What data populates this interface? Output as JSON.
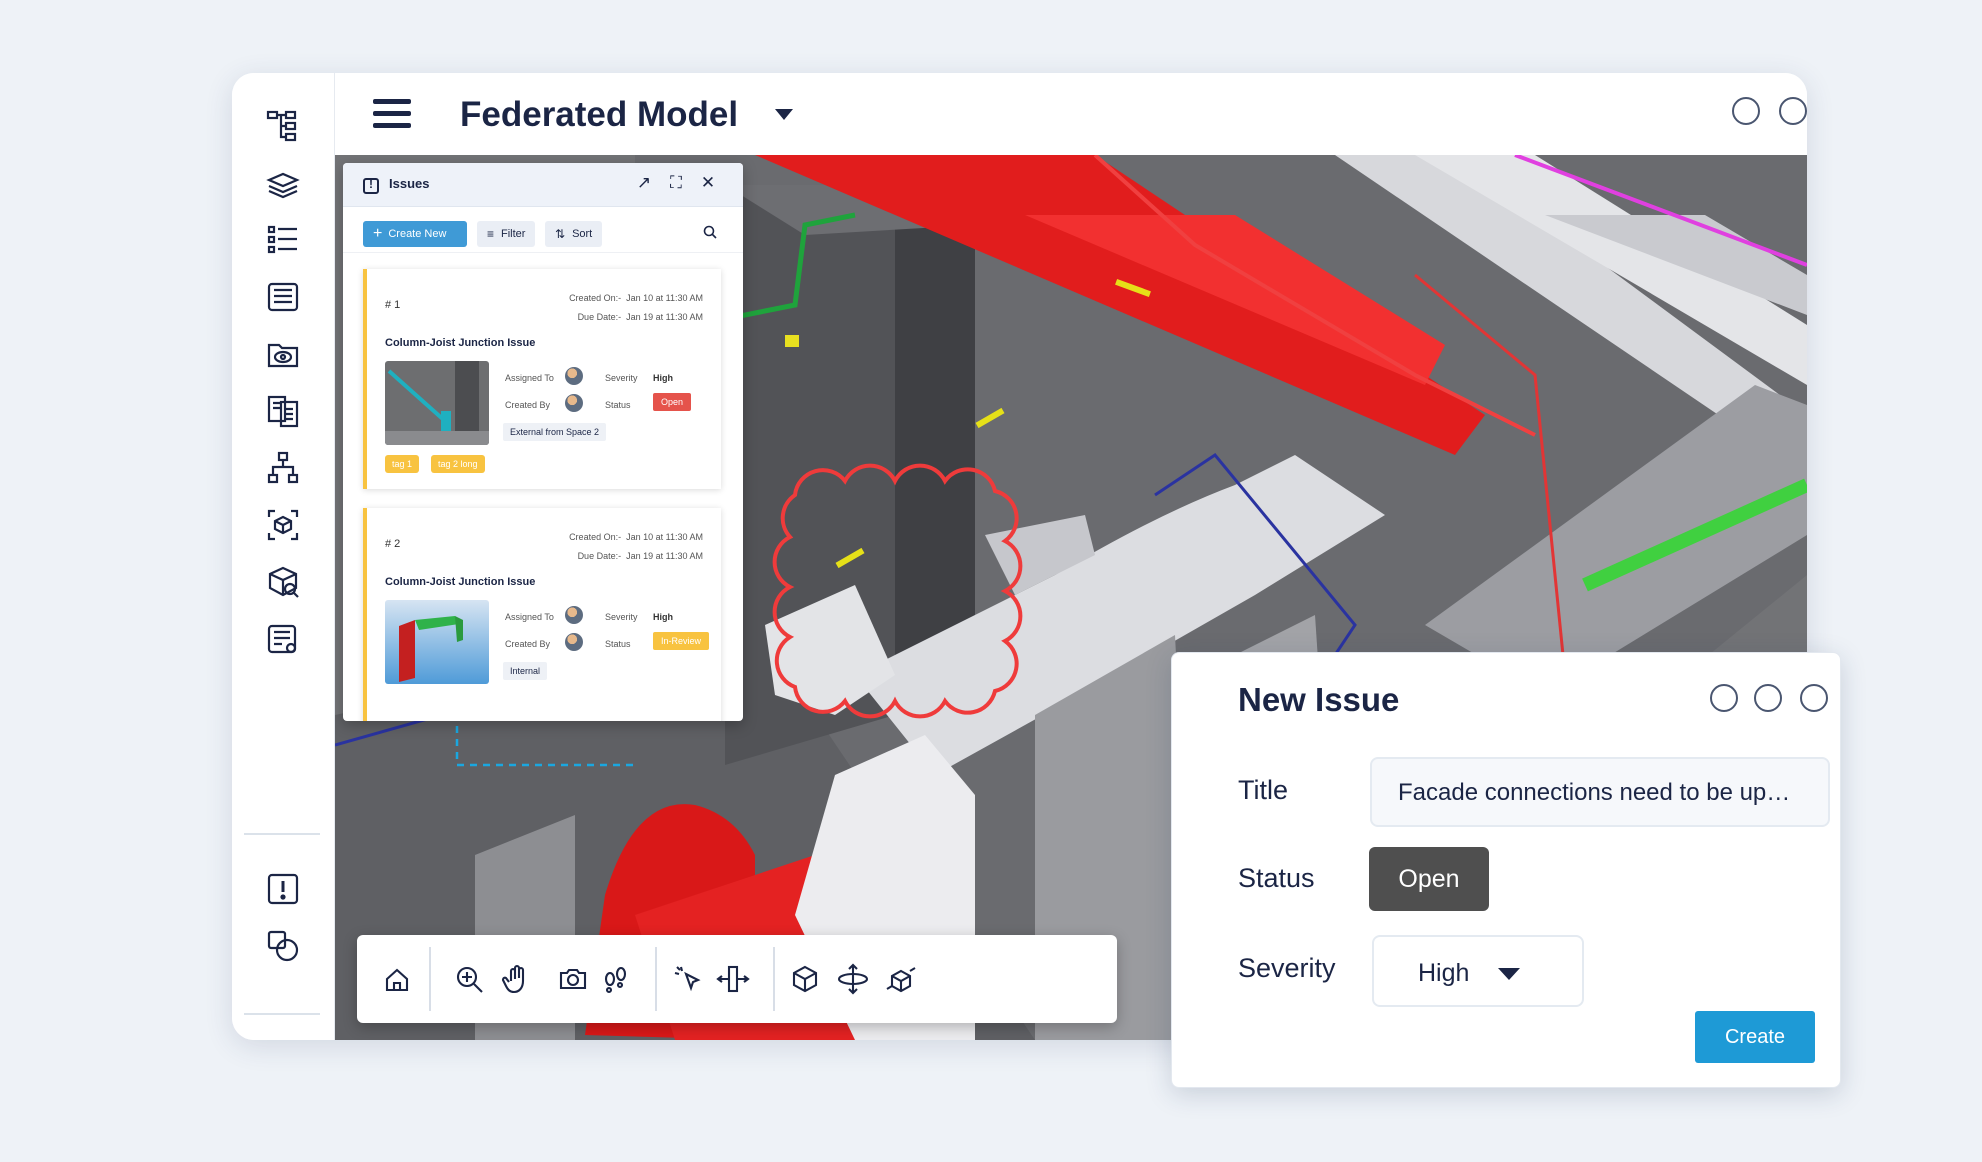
{
  "header": {
    "model_title": "Federated Model"
  },
  "sidebar": {
    "icons": [
      "model-tree-icon",
      "layers-icon",
      "list-icon",
      "properties-icon",
      "views-icon",
      "documents-icon",
      "hierarchy-icon",
      "objects-icon",
      "object-search-icon",
      "reports-icon",
      "issues-icon",
      "compare-icon"
    ]
  },
  "issues_panel": {
    "title": "Issues",
    "create_label": "Create New",
    "filter_label": "Filter",
    "sort_label": "Sort",
    "cards": [
      {
        "number": "#  1",
        "created_label": "Created On:-",
        "created_value": "Jan 10 at 11:30 AM",
        "due_label": "Due Date:-",
        "due_value": "Jan 19 at 11:30 AM",
        "name": "Column-Joist Junction Issue",
        "assigned_label": "Assigned To",
        "created_by_label": "Created By",
        "severity_label": "Severity",
        "severity_value": "High",
        "status_label": "Status",
        "status_value": "Open",
        "chip": "External from Space 2",
        "tags": [
          "tag 1",
          "tag 2 long"
        ]
      },
      {
        "number": "#  2",
        "created_label": "Created On:-",
        "created_value": "Jan 10 at 11:30 AM",
        "due_label": "Due Date:-",
        "due_value": "Jan 19 at 11:30 AM",
        "name": "Column-Joist Junction Issue",
        "assigned_label": "Assigned To",
        "created_by_label": "Created By",
        "severity_label": "Severity",
        "severity_value": "High",
        "status_label": "Status",
        "status_value": "In-Review",
        "chip": "Internal",
        "tags": []
      }
    ]
  },
  "toolbar": {
    "icons": [
      "home-icon",
      "zoom-icon",
      "pan-icon",
      "camera-icon",
      "walk-icon",
      "select-icon",
      "section-icon",
      "cube-icon",
      "orbit-icon",
      "explode-icon"
    ]
  },
  "new_issue": {
    "heading": "New Issue",
    "title_label": "Title",
    "title_value": "Facade connections need to be updated",
    "status_label": "Status",
    "status_value": "Open",
    "severity_label": "Severity",
    "severity_value": "High",
    "create_label": "Create"
  },
  "colors": {
    "accent": "#1e9ad6",
    "open": "#e5534b",
    "in_review": "#f8c340",
    "markup_cloud": "#ef3b3b"
  }
}
